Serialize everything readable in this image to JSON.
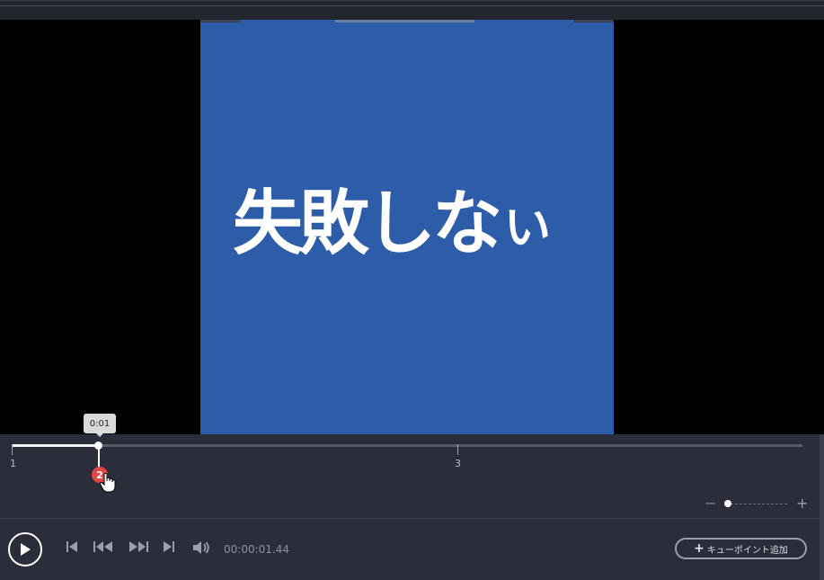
{
  "video": {
    "caption_main": "失敗しな",
    "caption_small": "い",
    "background_color": "#2d5ca8"
  },
  "timeline": {
    "ruler_labels": [
      "1",
      "3"
    ],
    "tooltip_time": "0:01",
    "cue_marker_number": "2",
    "progress_fraction": 0.11
  },
  "zoom": {
    "minus_label": "−",
    "plus_label": "+"
  },
  "controls": {
    "timecode": "00:00:01.44",
    "add_cue_label": "キューポイント追加",
    "icons": [
      "play-icon",
      "skip-to-start-icon",
      "rewind-icon",
      "fast-forward-icon",
      "skip-to-end-icon",
      "volume-icon"
    ]
  }
}
